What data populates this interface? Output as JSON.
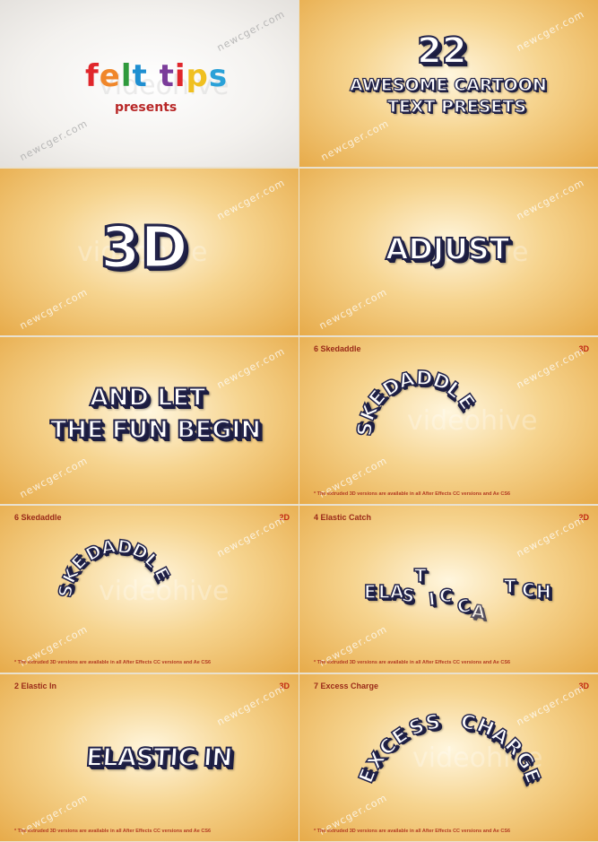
{
  "watermarks": {
    "newcger": "newcger.com",
    "videohive": "videohive"
  },
  "intro": {
    "brand": [
      "f",
      "e",
      "l",
      "t",
      " ",
      "t",
      "i",
      "p",
      "s"
    ],
    "brand_colors": [
      "#e0262b",
      "#f0872a",
      "#2f9a3c",
      "#1f8fd1",
      "#ffffff",
      "#7b3c9a",
      "#e0262b",
      "#f0c020",
      "#2aa1d8"
    ],
    "presents": "presents"
  },
  "title_card": {
    "number": "22",
    "line1": "AWESOME CARTOON",
    "line2": "TEXT PRESETS"
  },
  "card_3d": {
    "text": "3D"
  },
  "card_adjust": {
    "text": "ADJUST"
  },
  "card_fun": {
    "line1": "AND LET",
    "line2": "THE FUN BEGIN"
  },
  "skedaddle_3d": {
    "label": "6  Skedaddle",
    "badge": "3D",
    "letters": [
      "S",
      "K",
      "E",
      "D",
      "A",
      "D",
      "D",
      "L",
      "E"
    ],
    "footnote": "* The extruded 3D versions are available in all After Effects CC versions and Ae CS6"
  },
  "skedaddle_2d": {
    "label": "6  Skedaddle",
    "badge": "2D",
    "letters": [
      "S",
      "K",
      "E",
      "D",
      "A",
      "D",
      "D",
      "L",
      "E"
    ],
    "footnote": "* The extruded 3D versions are available in all After Effects CC versions and Ae CS6"
  },
  "elastic_catch": {
    "label": "4  Elastic Catch",
    "badge": "2D",
    "letters": [
      "E",
      "L",
      "A",
      "S",
      "T",
      "I",
      "C",
      "C",
      "A",
      "T",
      "C",
      "H"
    ],
    "footnote": "* The extruded 3D versions are available in all After Effects CC versions and Ae CS6"
  },
  "elastic_in": {
    "label": "2  Elastic In",
    "badge": "3D",
    "text": "ELASTIC IN",
    "footnote": "* The extruded 3D versions are available in all After Effects CC versions and Ae CS6"
  },
  "excess_charge": {
    "label": "7  Excess Charge",
    "badge": "3D",
    "letters": [
      "E",
      "X",
      "C",
      "E",
      "S",
      "S",
      " ",
      "C",
      "H",
      "A",
      "R",
      "G",
      "E"
    ],
    "footnote": "* The extruded 3D versions are available in all After Effects CC versions and Ae CS6"
  }
}
